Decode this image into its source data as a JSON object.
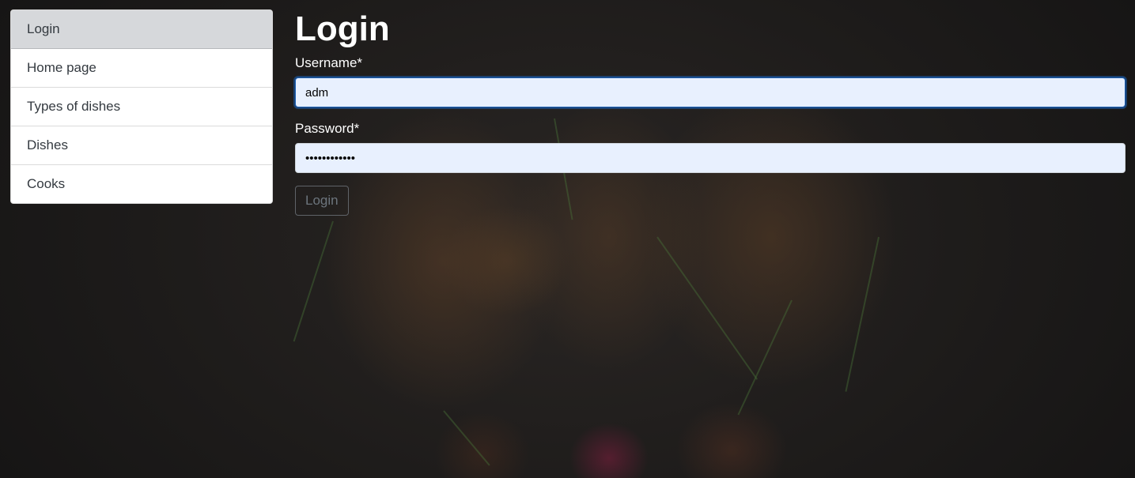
{
  "sidebar": {
    "items": [
      {
        "label": "Login",
        "active": true
      },
      {
        "label": "Home page",
        "active": false
      },
      {
        "label": "Types of dishes",
        "active": false
      },
      {
        "label": "Dishes",
        "active": false
      },
      {
        "label": "Cooks",
        "active": false
      }
    ]
  },
  "main": {
    "title": "Login",
    "username": {
      "label": "Username*",
      "value": "adm"
    },
    "password": {
      "label": "Password*",
      "value": "••••••••••••"
    },
    "submit_label": "Login"
  },
  "colors": {
    "sidebar_active_bg": "#d6d8db",
    "input_autofill_bg": "#e8f0fe",
    "focus_ring": "#1a5fb4"
  }
}
